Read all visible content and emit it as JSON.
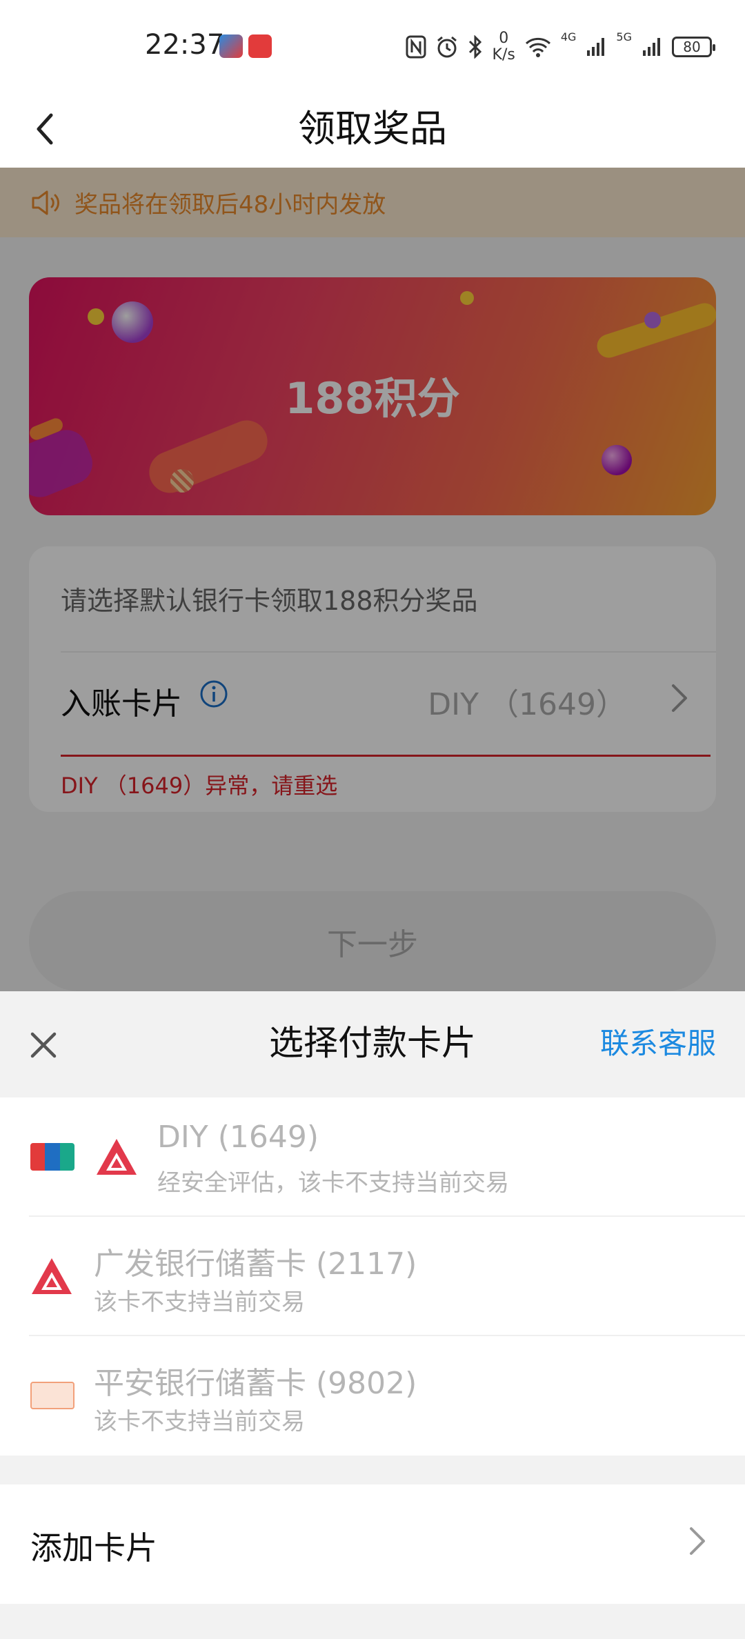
{
  "status_bar": {
    "time": "22:37",
    "net_speed_value": "0",
    "net_speed_unit": "K/s",
    "signal_1": "4G",
    "signal_2": "5G",
    "battery": "80"
  },
  "header": {
    "title": "领取奖品",
    "back_icon": "chevron-left-icon"
  },
  "notice": {
    "icon": "speaker-icon",
    "text": "奖品将在领取后48小时内发放"
  },
  "banner": {
    "points_text": "188积分"
  },
  "form": {
    "hint": "请选择默认银行卡领取188积分奖品",
    "card_label": "入账卡片",
    "card_value": "DIY （1649）",
    "error_text": "DIY （1649）异常，请重选"
  },
  "next_button": {
    "label": "下一步"
  },
  "sheet": {
    "title": "选择付款卡片",
    "contact_label": "联系客服",
    "cards": [
      {
        "title": "DIY (1649)",
        "subtitle": "经安全评估，该卡不支持当前交易"
      },
      {
        "title": "广发银行储蓄卡 (2117)",
        "subtitle": "该卡不支持当前交易"
      },
      {
        "title": "平安银行储蓄卡 (9802)",
        "subtitle": "该卡不支持当前交易"
      }
    ],
    "add_card_label": "添加卡片"
  },
  "colors": {
    "accent_blue": "#1b89e0",
    "error_red": "#d9232a",
    "notice_orange": "#e88a2c",
    "notice_bg": "#fbe8cf"
  }
}
